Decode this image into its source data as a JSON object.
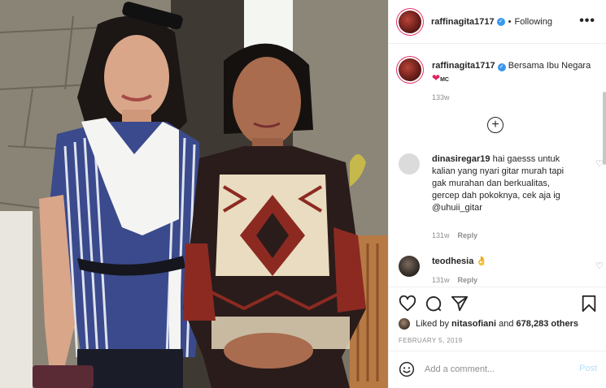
{
  "post": {
    "username": "raffinagita1717",
    "follow_status": "Following",
    "more_icon": "more-options-icon",
    "caption": {
      "username": "raffinagita1717",
      "text": "Bersama Ibu Negara",
      "emoji": "❤",
      "emoji_suffix": "MC",
      "time": "133w"
    },
    "load_more_icon": "plus-circle-icon",
    "comments": [
      {
        "username": "dinasiregar19",
        "text": "hai gaesss untuk kalian yang nyari gitar murah tapi gak murahan dan berkualitas, gercep dah pokoknya, cek aja ig @uhuii_gitar",
        "time": "131w",
        "reply_label": "Reply"
      },
      {
        "username": "teodhesia",
        "text": "👌",
        "time": "131w",
        "reply_label": "Reply"
      }
    ],
    "actions": {
      "like_icon": "heart-icon",
      "comment_icon": "comment-icon",
      "share_icon": "share-icon",
      "save_icon": "bookmark-icon"
    },
    "likes": {
      "prefix": "Liked by",
      "user": "nitasofiani",
      "middle": "and",
      "count": "678,283 others"
    },
    "date": "FEBRUARY 5, 2019",
    "add_comment": {
      "placeholder": "Add a comment...",
      "post_label": "Post"
    }
  },
  "colors": {
    "verified": "#3897f0",
    "heart": "#e0245e",
    "post_button": "#b2dffc",
    "muted": "#8e8e8e"
  }
}
